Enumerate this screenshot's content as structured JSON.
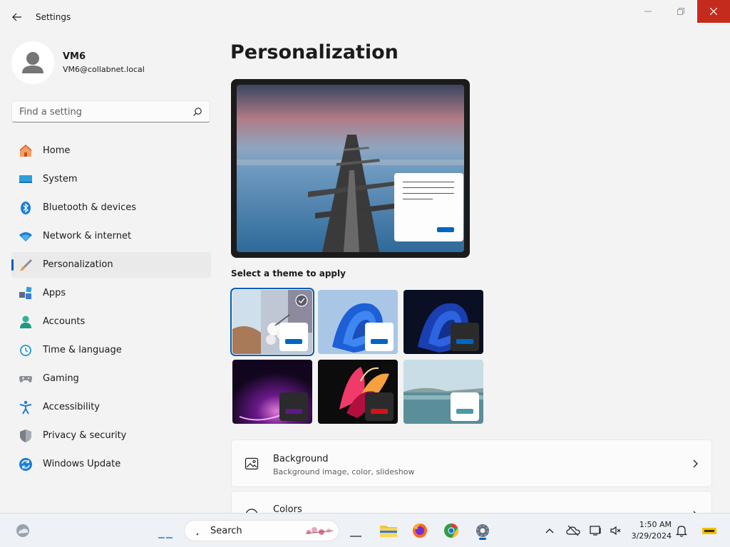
{
  "window": {
    "title": "Settings",
    "controls": [
      "minimize",
      "restore",
      "close"
    ]
  },
  "user": {
    "name": "VM6",
    "email": "VM6@collabnet.local"
  },
  "search": {
    "placeholder": "Find a setting"
  },
  "nav": {
    "items": [
      {
        "label": "Home",
        "icon": "home-icon"
      },
      {
        "label": "System",
        "icon": "system-icon"
      },
      {
        "label": "Bluetooth & devices",
        "icon": "bluetooth-icon"
      },
      {
        "label": "Network & internet",
        "icon": "wifi-icon"
      },
      {
        "label": "Personalization",
        "icon": "brush-icon",
        "active": true
      },
      {
        "label": "Apps",
        "icon": "apps-icon"
      },
      {
        "label": "Accounts",
        "icon": "accounts-icon"
      },
      {
        "label": "Time & language",
        "icon": "clock-icon"
      },
      {
        "label": "Gaming",
        "icon": "gamepad-icon"
      },
      {
        "label": "Accessibility",
        "icon": "accessibility-icon"
      },
      {
        "label": "Privacy & security",
        "icon": "shield-icon"
      },
      {
        "label": "Windows Update",
        "icon": "update-icon"
      }
    ]
  },
  "main": {
    "title": "Personalization",
    "themes_label": "Select a theme to apply",
    "themes": [
      {
        "selected": true,
        "card_color": "#ffffff",
        "bar_color": "#0067c0"
      },
      {
        "selected": false,
        "card_color": "#ffffff",
        "bar_color": "#0067c0"
      },
      {
        "selected": false,
        "card_color": "#2b2b2b",
        "bar_color": "#0067c0"
      },
      {
        "selected": false,
        "card_color": "#2b2b2b",
        "bar_color": "#5a1a8a"
      },
      {
        "selected": false,
        "card_color": "#2b2b2b",
        "bar_color": "#d4121b"
      },
      {
        "selected": false,
        "card_color": "#ffffff",
        "bar_color": "#4a9aa8"
      }
    ],
    "settings": [
      {
        "title": "Background",
        "subtitle": "Background image, color, slideshow",
        "icon": "image-icon"
      },
      {
        "title": "Colors",
        "subtitle": "",
        "icon": "palette-icon"
      }
    ]
  },
  "taskbar": {
    "search_label": "Search",
    "time": "1:50 AM",
    "date": "3/29/2024"
  },
  "colors": {
    "accent": "#005fb8",
    "close": "#c42b1c"
  }
}
